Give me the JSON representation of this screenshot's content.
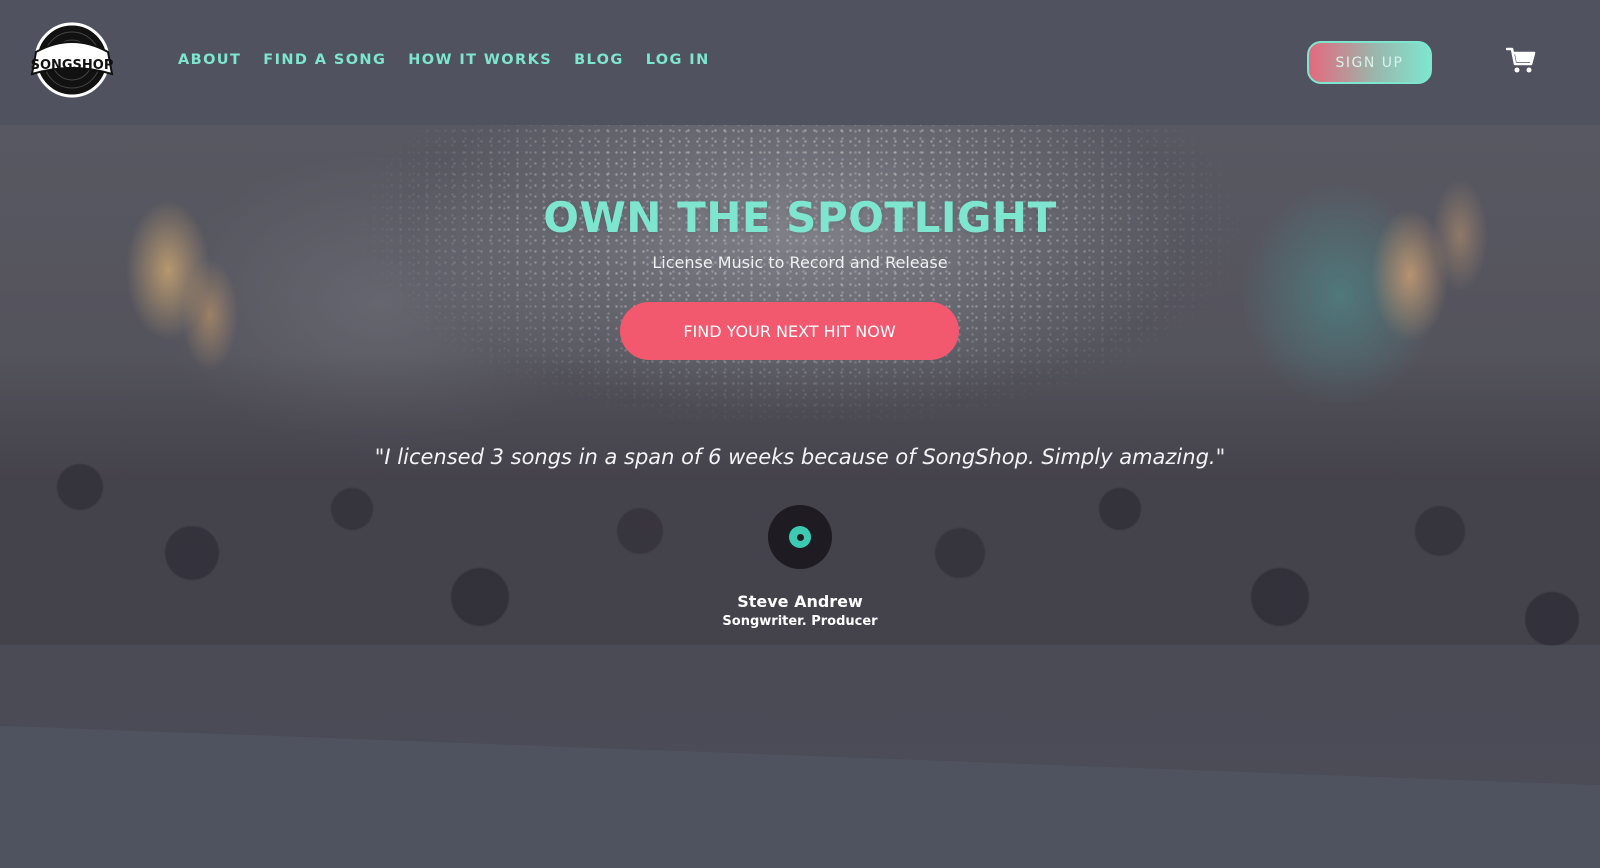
{
  "brand": {
    "logo_text": "SONGSHOP",
    "logo_icon": "vinyl-record-icon"
  },
  "nav": {
    "items": [
      {
        "label": "ABOUT"
      },
      {
        "label": "FIND A SONG"
      },
      {
        "label": "HOW IT WORKS"
      },
      {
        "label": "BLOG"
      },
      {
        "label": "LOG IN"
      }
    ],
    "signup_label": "SIGN UP",
    "cart_icon": "shopping-cart-icon"
  },
  "hero": {
    "title": "OWN THE SPOTLIGHT",
    "subtitle": "License Music to Record and Release",
    "cta_label": "FIND YOUR NEXT HIT NOW",
    "background": "concert-crowd-confetti-photo"
  },
  "testimonial": {
    "quote": "\"I licensed 3 songs in a span of 6 weeks because of SongShop. Simply amazing.\"",
    "avatar_icon": "vinyl-avatar-icon",
    "author_name": "Steve Andrew",
    "author_role": "Songwriter. Producer"
  },
  "colors": {
    "accent_teal": "#7ee6cf",
    "accent_pink": "#f2586e",
    "background": "#4f525f"
  }
}
